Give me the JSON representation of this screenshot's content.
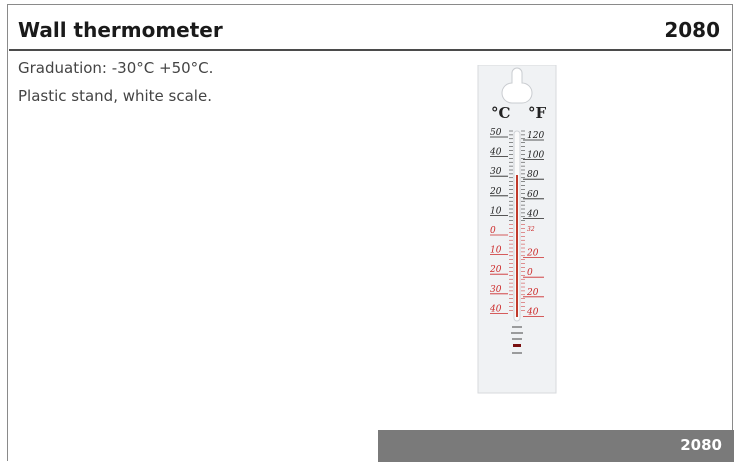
{
  "product": {
    "title": "Wall thermometer",
    "code": "2080",
    "description": [
      "Graduation: -30°C +50°C.",
      "Plastic stand, white scale."
    ],
    "footer_code": "2080"
  },
  "thermometer": {
    "celsius_unit": "°C",
    "fahrenheit_unit": "°F",
    "celsius_labels": [
      "50",
      "40",
      "30",
      "20",
      "10",
      "0",
      "10",
      "20",
      "30",
      "40"
    ],
    "fahrenheit_labels": [
      "120",
      "100",
      "80",
      "60",
      "40",
      "32",
      "20",
      "0",
      "20",
      "40"
    ]
  },
  "colors": {
    "scale_dark": "#222222",
    "scale_red": "#cc2a2a",
    "footer_bg": "#7a7a7a"
  }
}
